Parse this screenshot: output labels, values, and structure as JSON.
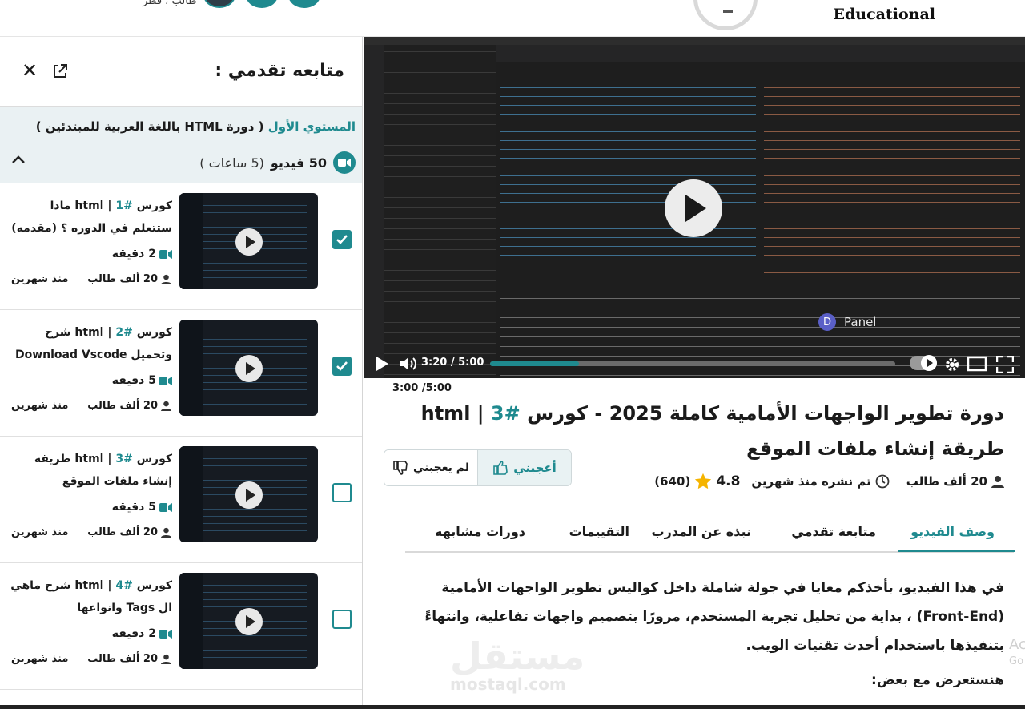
{
  "header": {
    "brand": "Educational",
    "user_line": "طالب ، قطر"
  },
  "sidebar": {
    "title": "متابعه تقدمي :",
    "level": {
      "name": "المستوي الأول",
      "course": "( دورة HTML باللغة العربية للمبتدئين )",
      "videos": "50 فيديو",
      "hours": "(5 ساعات )"
    },
    "lessons": [
      {
        "num": "#1",
        "prefix": "كورس",
        "title": "| html ماذا ستتعلم في الدوره ؟ (مقدمه)",
        "duration": "2 دقيقه",
        "students": "20 ألف طالب",
        "ago": "منذ شهرين",
        "done": true
      },
      {
        "num": "#2",
        "prefix": "كورس",
        "title": "| html شرح وتحميل Download Vscode",
        "duration": "5 دقيقه",
        "students": "20 ألف طالب",
        "ago": "منذ شهرين",
        "done": true
      },
      {
        "num": "#3",
        "prefix": "كورس",
        "title": "| html طريقه إنشاء ملفات الموقع",
        "duration": "5 دقيقه",
        "students": "20 ألف طالب",
        "ago": "منذ شهرين",
        "done": false
      },
      {
        "num": "#4",
        "prefix": "كورس",
        "title": "| html شرح ماهي ال Tags وانواعها",
        "duration": "2 دقيقه",
        "students": "20 ألف طالب",
        "ago": "منذ شهرين",
        "done": false
      }
    ]
  },
  "player": {
    "time": "3:20 / 5:00",
    "progress": 0.22,
    "panel_label": "Panel",
    "panel_avatar": "D"
  },
  "video": {
    "time_below": "3:00 /5:00",
    "title_main": "دورة تطوير الواجهات الأمامية كاملة 2025 - كورس",
    "title_num": "#3",
    "title_rest": "| html طريقة إنشاء ملفات الموقع",
    "like": "أعجبني",
    "dislike": "لم يعجبني",
    "students": "20 ألف طالب",
    "published": "تم نشره منذ شهرين",
    "rating": "4.8",
    "rating_count": "(640)"
  },
  "tabs": [
    "وصف الفيديو",
    "متابعة تقدمي",
    "نبذه عن المدرب",
    "التقييمات",
    "دورات مشابهه"
  ],
  "description": "في هذا الفيديو، بأخذكم معايا في جولة شاملة داخل كواليس تطوير الواجهات الأمامية (Front-End) ، بداية من تحليل تجربة المستخدم، مرورًا بتصميم واجهات تفاعلية، وانتهاءً بتنفيذها باستخدام أحدث تقنيات الويب.",
  "subheading": "هنستعرض مع بعض:",
  "watermark": {
    "ar": "مستقل",
    "en": "mostaql.com"
  },
  "edge_text": {
    "a": "Ac",
    "b": "Go"
  },
  "colors": {
    "accent": "#1f8a8f"
  }
}
